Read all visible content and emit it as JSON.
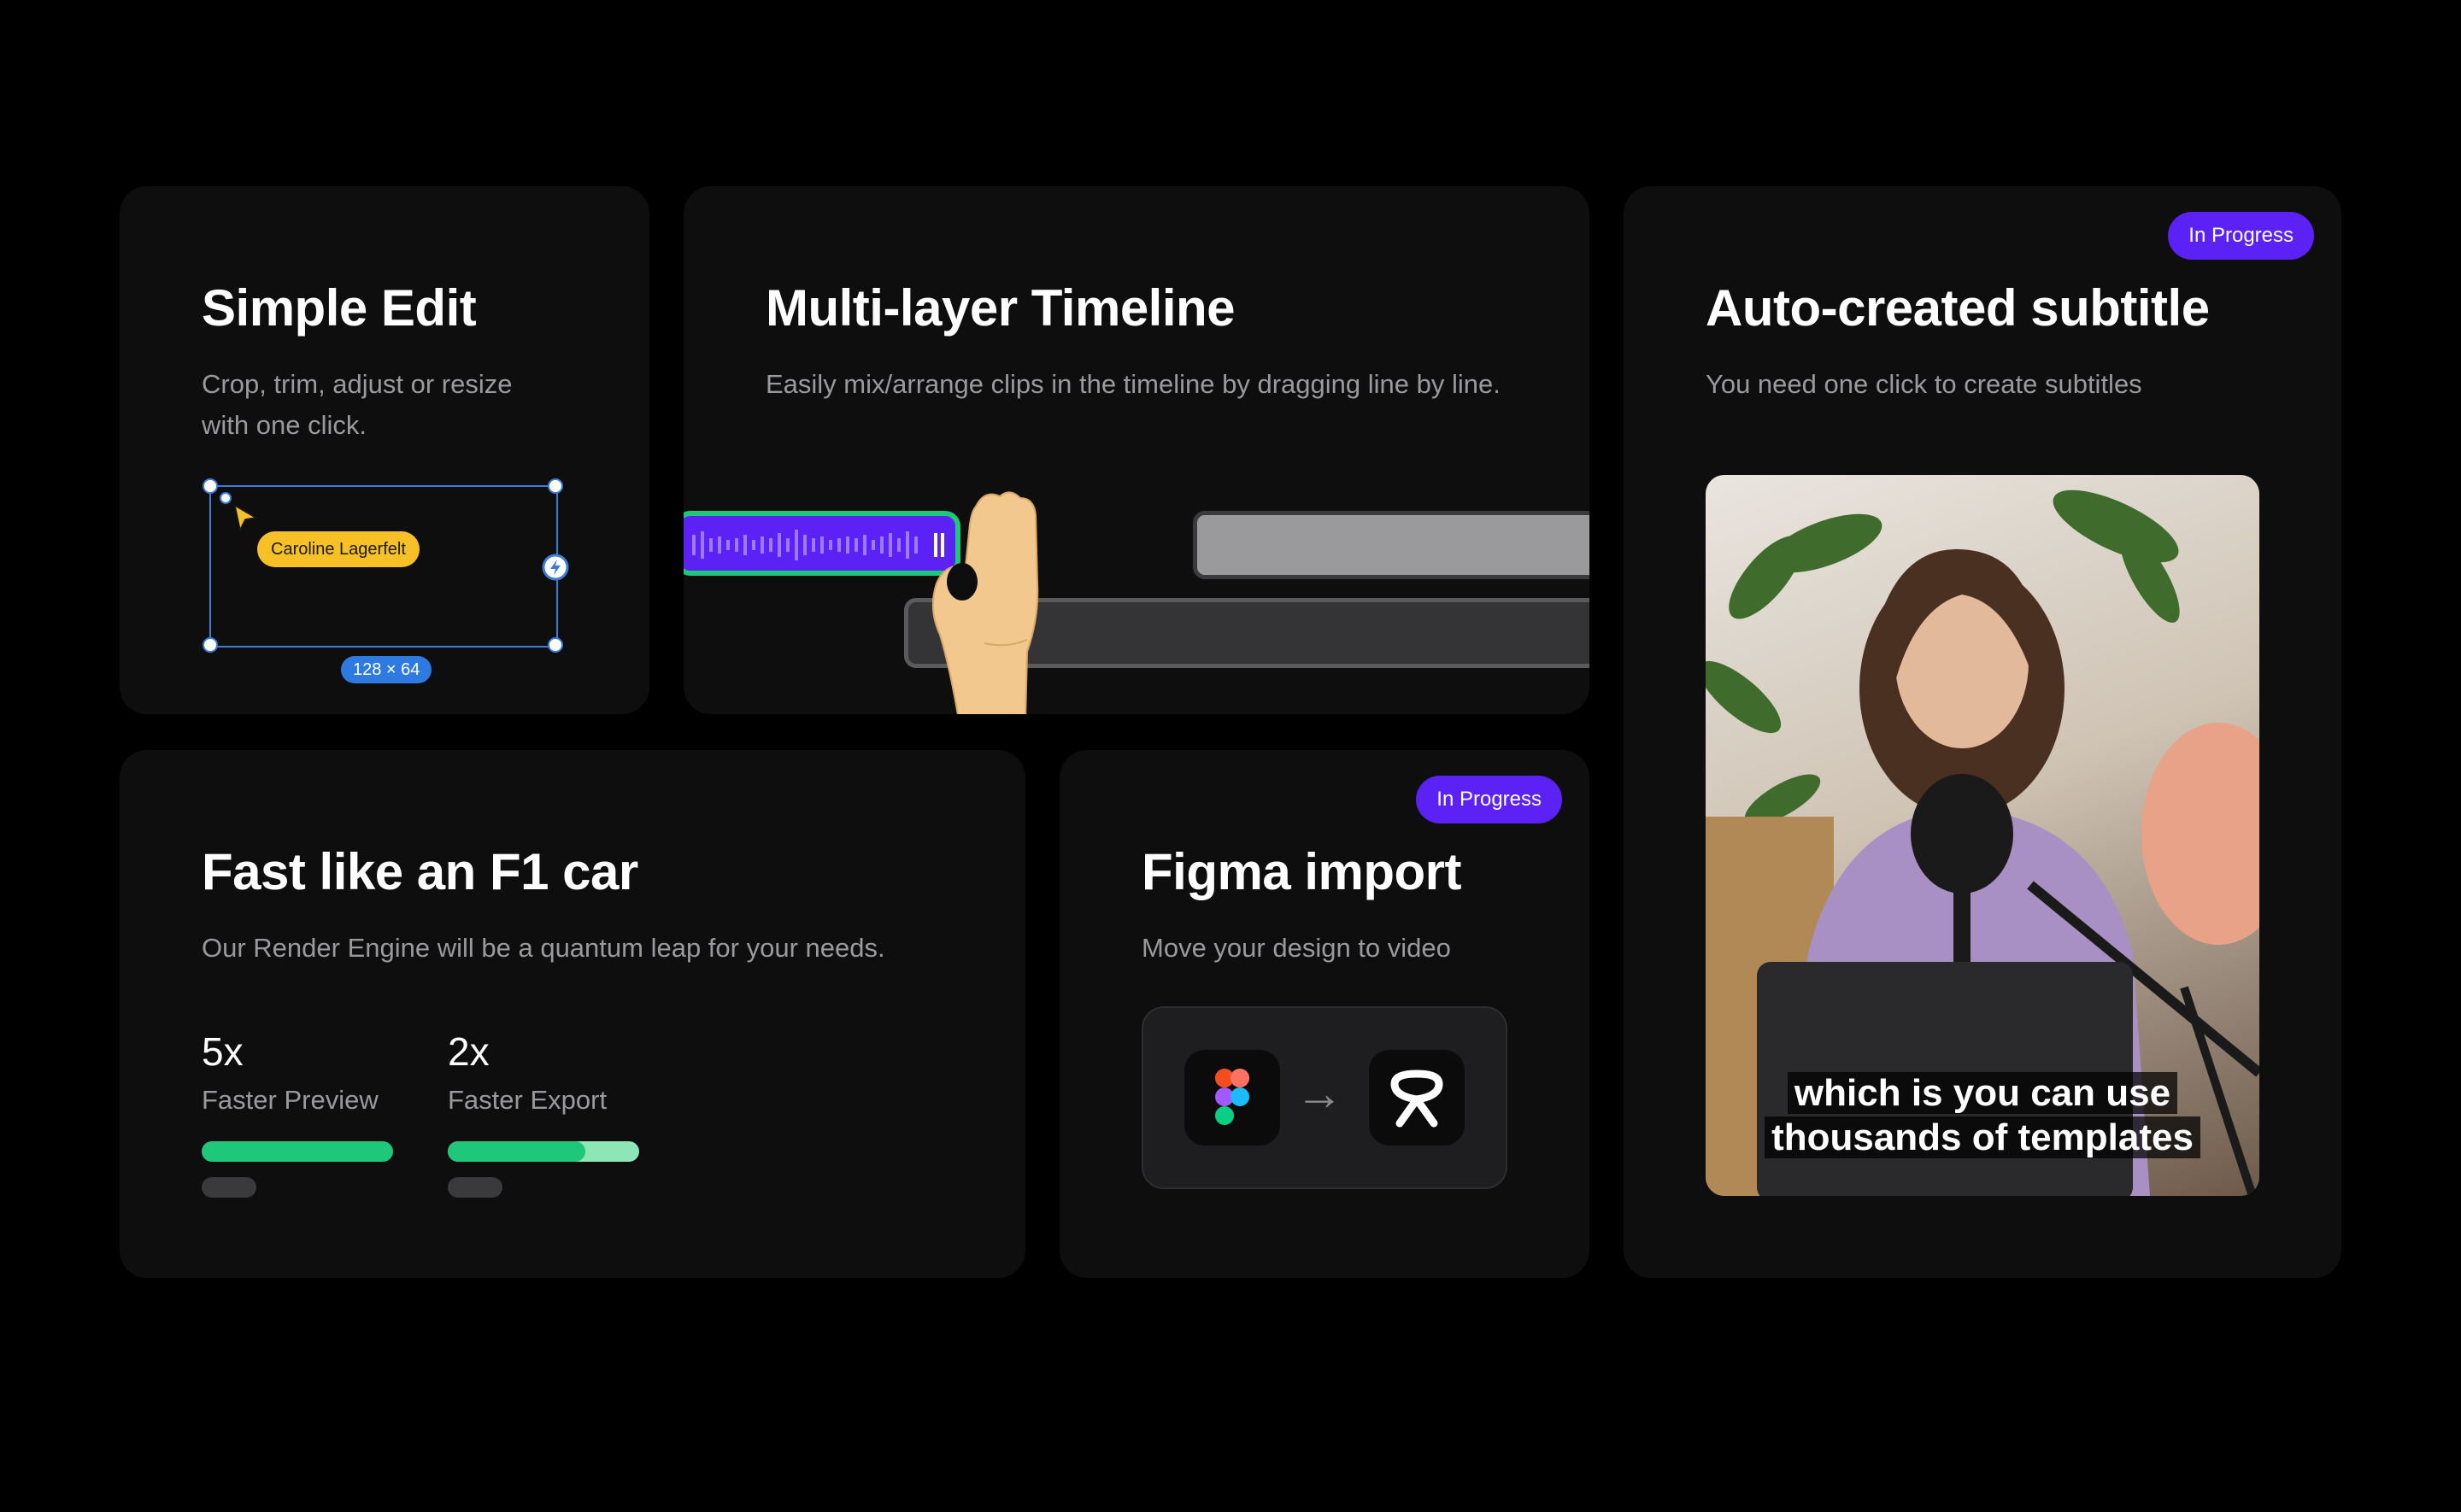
{
  "cards": {
    "simple_edit": {
      "title": "Simple Edit",
      "desc": "Crop, trim, adjust or resize with one click.",
      "tag": "Caroline Lagerfelt",
      "size": "128 × 64"
    },
    "timeline": {
      "title": "Multi-layer Timeline",
      "desc": "Easily mix/arrange clips in the timeline by dragging line by line."
    },
    "subtitle": {
      "title": "Auto-created subtitle",
      "desc": "You need one click to create subtitles",
      "badge": "In Progress",
      "caption_line1": "which is you can use",
      "caption_line2": "thousands of templates"
    },
    "fast": {
      "title": "Fast like an F1 car",
      "desc": "Our Render Engine will be a quantum leap for your needs.",
      "stats": [
        {
          "value": "5x",
          "label": "Faster Preview",
          "progress": 1.0
        },
        {
          "value": "2x",
          "label": "Faster Export",
          "progress": 0.72
        }
      ]
    },
    "figma": {
      "title": "Figma import",
      "desc": "Move your design to video",
      "badge": "In Progress",
      "arrow": "→"
    }
  },
  "colors": {
    "accent_purple": "#5b21f5",
    "accent_green": "#1fc77a",
    "accent_green_light": "#8ee6b6",
    "selection_blue": "#3d7bd8",
    "tag_yellow": "#f6c026"
  },
  "icons": [
    "cursor-icon",
    "lightning-icon",
    "hand-icon",
    "figma-icon",
    "app-logo-icon",
    "arrow-right-icon"
  ]
}
